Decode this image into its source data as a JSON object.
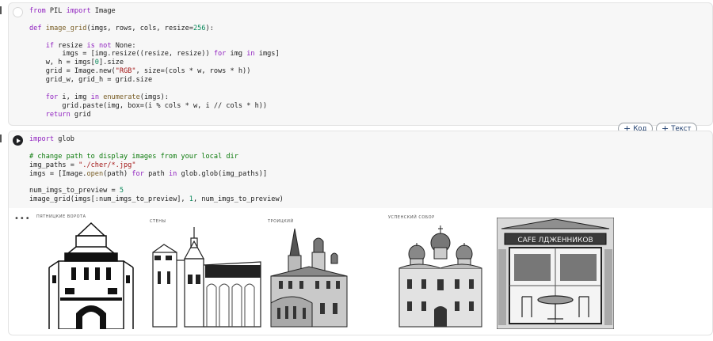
{
  "cell1": {
    "lines": [
      [
        {
          "t": "from",
          "c": "kw"
        },
        {
          "t": " PIL "
        },
        {
          "t": "import",
          "c": "kw"
        },
        {
          "t": " Image"
        }
      ],
      [],
      [
        {
          "t": "def",
          "c": "kw"
        },
        {
          "t": " "
        },
        {
          "t": "image_grid",
          "c": "fn"
        },
        {
          "t": "(imgs, rows, cols, resize="
        },
        {
          "t": "256",
          "c": "num"
        },
        {
          "t": "):"
        }
      ],
      [],
      [
        {
          "t": "    "
        },
        {
          "t": "if",
          "c": "kw"
        },
        {
          "t": " resize "
        },
        {
          "t": "is not",
          "c": "kw"
        },
        {
          "t": " None:"
        }
      ],
      [
        {
          "t": "        imgs = [img.resize((resize, resize)) "
        },
        {
          "t": "for",
          "c": "kw"
        },
        {
          "t": " img "
        },
        {
          "t": "in",
          "c": "kw"
        },
        {
          "t": " imgs]"
        }
      ],
      [
        {
          "t": "    w, h = imgs["
        },
        {
          "t": "0",
          "c": "num"
        },
        {
          "t": "].size"
        }
      ],
      [
        {
          "t": "    grid = Image.new("
        },
        {
          "t": "\"RGB\"",
          "c": "str"
        },
        {
          "t": ", size=(cols * w, rows * h))"
        }
      ],
      [
        {
          "t": "    grid_w, grid_h = grid.size"
        }
      ],
      [],
      [
        {
          "t": "    "
        },
        {
          "t": "for",
          "c": "kw"
        },
        {
          "t": " i, img "
        },
        {
          "t": "in",
          "c": "kw"
        },
        {
          "t": " "
        },
        {
          "t": "enumerate",
          "c": "fn"
        },
        {
          "t": "(imgs):"
        }
      ],
      [
        {
          "t": "        grid.paste(img, box=(i % cols * w, i // cols * h))"
        }
      ],
      [
        {
          "t": "    "
        },
        {
          "t": "return",
          "c": "kw"
        },
        {
          "t": " grid"
        }
      ]
    ]
  },
  "cell2": {
    "lines": [
      [
        {
          "t": "import",
          "c": "kw"
        },
        {
          "t": " glob"
        }
      ],
      [],
      [
        {
          "t": "# change path to display images from your local dir",
          "c": "com"
        }
      ],
      [
        {
          "t": "img_paths = "
        },
        {
          "t": "\"./cher/*.jpg\"",
          "c": "str"
        }
      ],
      [
        {
          "t": "imgs = [Image."
        },
        {
          "t": "open",
          "c": "fn"
        },
        {
          "t": "(path) "
        },
        {
          "t": "for",
          "c": "kw"
        },
        {
          "t": " path "
        },
        {
          "t": "in",
          "c": "kw"
        },
        {
          "t": " glob.glob(img_paths)]"
        }
      ],
      [],
      [
        {
          "t": "num_imgs_to_preview = "
        },
        {
          "t": "5",
          "c": "num"
        }
      ],
      [
        {
          "t": "image_grid(imgs[:num_imgs_to_preview], "
        },
        {
          "t": "1",
          "c": "num"
        },
        {
          "t": ", num_imgs_to_preview)"
        }
      ]
    ]
  },
  "toolbar": {
    "add_code_label": "Код",
    "add_text_label": "Текст"
  },
  "output": {
    "more_label": "•••",
    "sign_text": "CAFE ЛДЖЕННИКОВ",
    "captions": [
      "ПЯТНИЦКИЕ ВОРОТА",
      "СТЕНЫ",
      "ТРОИЦКИЙ",
      "УСПЕНСКИЙ СОБОР",
      ""
    ]
  },
  "colors": {
    "keyword": "#8f1fbf",
    "string": "#a31515",
    "number": "#09885a",
    "comment": "#0b7a0b",
    "function": "#795e26"
  }
}
